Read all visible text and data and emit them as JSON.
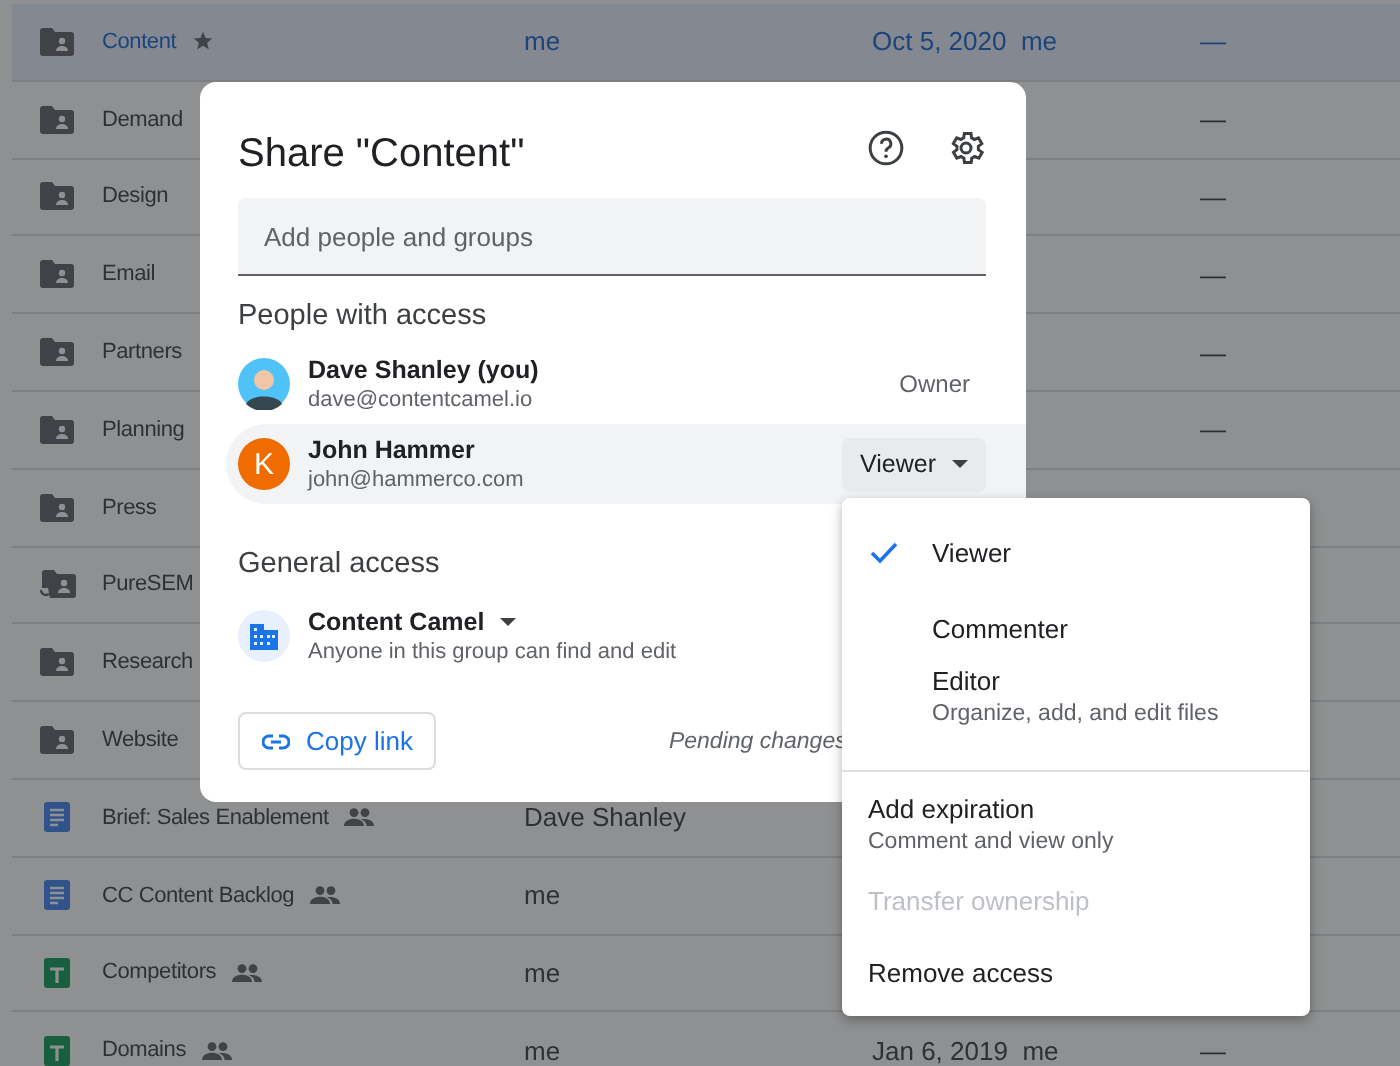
{
  "file_list": {
    "rows": [
      {
        "name": "Content",
        "kind": "folder",
        "starred": true,
        "shared": false,
        "selected": true,
        "owner": "me",
        "modified": "Oct 5, 2020",
        "modified_by": "me",
        "size": "—"
      },
      {
        "name": "Demand",
        "kind": "folder",
        "starred": false,
        "shared": false,
        "selected": false,
        "size": "—"
      },
      {
        "name": "Design",
        "kind": "folder",
        "starred": false,
        "shared": false,
        "selected": false,
        "size": "—"
      },
      {
        "name": "Email",
        "kind": "folder",
        "starred": false,
        "shared": false,
        "selected": false,
        "size": "—"
      },
      {
        "name": "Partners",
        "kind": "folder",
        "starred": false,
        "shared": false,
        "selected": false,
        "size": "—"
      },
      {
        "name": "Planning",
        "kind": "folder",
        "starred": false,
        "shared": false,
        "selected": false,
        "size": "—"
      },
      {
        "name": "Press",
        "kind": "folder",
        "starred": false,
        "shared": false,
        "selected": false
      },
      {
        "name": "PureSEM",
        "kind": "shortcut",
        "starred": false,
        "shared": false,
        "selected": false
      },
      {
        "name": "Research",
        "kind": "folder",
        "starred": false,
        "shared": false,
        "selected": false
      },
      {
        "name": "Website",
        "kind": "folder",
        "starred": false,
        "shared": false,
        "selected": false
      },
      {
        "name": "Brief: Sales Enablement",
        "kind": "doc",
        "starred": false,
        "shared": true,
        "selected": false,
        "owner": "Dave Shanley"
      },
      {
        "name": "CC Content Backlog",
        "kind": "doc",
        "starred": false,
        "shared": true,
        "selected": false,
        "owner": "me"
      },
      {
        "name": "Competitors",
        "kind": "sheet",
        "starred": false,
        "shared": true,
        "selected": false,
        "owner": "me"
      },
      {
        "name": "Domains",
        "kind": "sheet",
        "starred": false,
        "shared": true,
        "selected": false,
        "owner": "me",
        "modified": "Jan 6, 2019",
        "modified_by": "me",
        "size": "—"
      }
    ]
  },
  "share_dialog": {
    "title": "Share \"Content\"",
    "search": {
      "placeholder": "Add people and groups"
    },
    "people_heading": "People with access",
    "people": [
      {
        "name": "Dave Shanley (you)",
        "email": "dave@contentcamel.io",
        "role": "Owner",
        "role_menu": false,
        "highlighted": false
      },
      {
        "name": "John Hammer",
        "email": "john@hammerco.com",
        "role": "Viewer",
        "role_menu": true,
        "initial": "K",
        "color": "#ef6c00",
        "highlighted": true
      }
    ],
    "general_heading": "General access",
    "general": {
      "name": "Content Camel",
      "description": "Anyone in this group can find and edit"
    },
    "copy_link": "Copy link",
    "pending": "Pending changes"
  },
  "role_menu": {
    "roles": [
      {
        "label": "Viewer",
        "selected": true
      },
      {
        "label": "Commenter",
        "selected": false
      },
      {
        "label": "Editor",
        "description": "Organize, add, and edit files",
        "selected": false
      }
    ],
    "actions": [
      {
        "label": "Add expiration",
        "description": "Comment and view only",
        "disabled": false
      },
      {
        "label": "Transfer ownership",
        "disabled": true
      },
      {
        "label": "Remove access",
        "disabled": false
      }
    ]
  }
}
